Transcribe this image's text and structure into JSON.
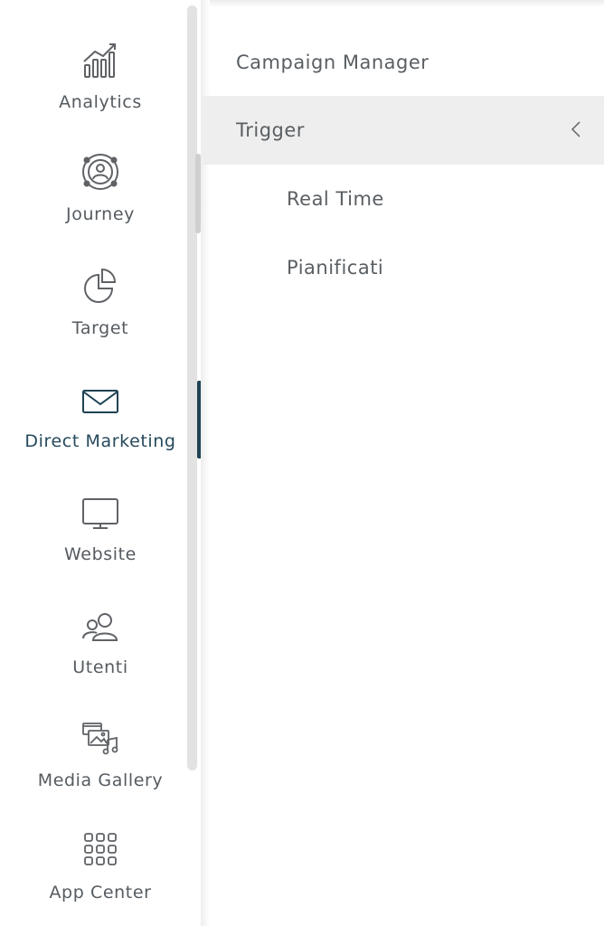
{
  "sidebar": {
    "items": [
      {
        "label": "Analytics",
        "icon": "analytics-chart-icon"
      },
      {
        "label": "Journey",
        "icon": "journey-icon"
      },
      {
        "label": "Target",
        "icon": "pie-chart-icon"
      },
      {
        "label": "Direct Marketing",
        "icon": "envelope-icon",
        "active": true
      },
      {
        "label": "Website",
        "icon": "monitor-icon"
      },
      {
        "label": "Utenti",
        "icon": "users-icon"
      },
      {
        "label": "Media Gallery",
        "icon": "media-gallery-icon"
      },
      {
        "label": "App Center",
        "icon": "grid-apps-icon"
      }
    ]
  },
  "submenu": {
    "header": "Campaign Manager",
    "group": {
      "label": "Trigger",
      "expanded": true
    },
    "children": [
      {
        "label": "Real Time"
      },
      {
        "label": "Pianificati"
      }
    ]
  },
  "colors": {
    "accent": "#1f4253",
    "active_text": "#26495c",
    "text": "#555b60",
    "selected_row": "#eeeeee"
  }
}
